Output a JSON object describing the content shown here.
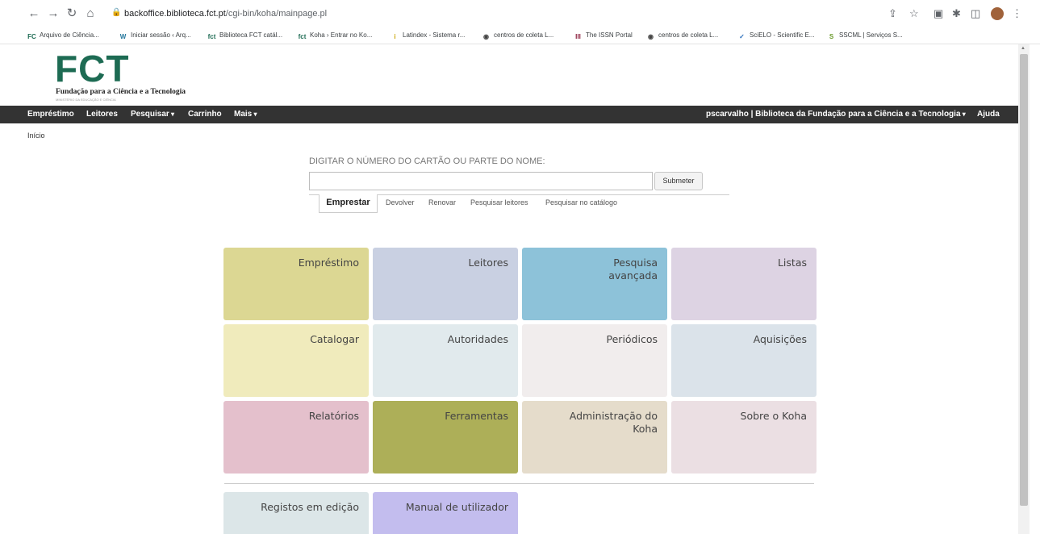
{
  "browser": {
    "url_host": "backoffice.biblioteca.fct.pt",
    "url_path": "/cgi-bin/koha/mainpage.pl",
    "bookmarks": [
      {
        "icon": "FC",
        "label": "Arquivo de Ciência..."
      },
      {
        "icon": "W",
        "label": "Iniciar sessão ‹ Arq..."
      },
      {
        "icon": "fct",
        "label": "Biblioteca FCT catál..."
      },
      {
        "icon": "fct",
        "label": "Koha › Entrar no Ko..."
      },
      {
        "icon": "i",
        "label": "Latindex - Sistema r..."
      },
      {
        "icon": "globe",
        "label": "centros de coleta L..."
      },
      {
        "icon": "ISSN",
        "label": "The ISSN Portal"
      },
      {
        "icon": "globe",
        "label": "centros de coleta L..."
      },
      {
        "icon": "scielo",
        "label": "SciELO - Scientific E..."
      },
      {
        "icon": "sscml",
        "label": "SSCML | Serviços S..."
      }
    ]
  },
  "logo": {
    "mark": "FCT",
    "name": "Fundação para a Ciência e a Tecnologia",
    "subtitle": "MINISTÉRIO DA EDUCAÇÃO E CIÊNCIA"
  },
  "navbar": {
    "left": [
      {
        "label": "Empréstimo",
        "dropdown": false
      },
      {
        "label": "Leitores",
        "dropdown": false
      },
      {
        "label": "Pesquisar",
        "dropdown": true
      },
      {
        "label": "Carrinho",
        "dropdown": false
      },
      {
        "label": "Mais",
        "dropdown": true
      }
    ],
    "user": "pscarvalho",
    "separator": "|",
    "library": "Biblioteca da Fundação para a Ciência e a Tecnologia",
    "help": "Ajuda",
    "caret": "▾"
  },
  "breadcrumb": "Início",
  "search": {
    "label": "DIGITAR O NÚMERO DO CARTÃO OU PARTE DO NOME:",
    "value": "",
    "submit": "Submeter",
    "tabs": [
      {
        "label": "Emprestar",
        "active": true
      },
      {
        "label": "Devolver",
        "active": false
      },
      {
        "label": "Renovar",
        "active": false
      },
      {
        "label": "Pesquisar leitores",
        "active": false
      },
      {
        "label": "Pesquisar no catálogo",
        "active": false
      }
    ]
  },
  "modules": [
    {
      "label": "Empréstimo",
      "color": "#dcd793"
    },
    {
      "label": "Leitores",
      "color": "#c9d0e2"
    },
    {
      "label": "Pesquisa avançada",
      "color": "#8dc2d9"
    },
    {
      "label": "Listas",
      "color": "#ddd3e3"
    },
    {
      "label": "Catalogar",
      "color": "#f0ebbc"
    },
    {
      "label": "Autoridades",
      "color": "#e1eaed"
    },
    {
      "label": "Periódicos",
      "color": "#f1eded"
    },
    {
      "label": "Aquisições",
      "color": "#dbe3ea"
    },
    {
      "label": "Relatórios",
      "color": "#e4c0cc"
    },
    {
      "label": "Ferramentas",
      "color": "#adaf58"
    },
    {
      "label": "Administração do Koha",
      "color": "#e5dccb"
    },
    {
      "label": "Sobre o Koha",
      "color": "#ebdfe3"
    }
  ],
  "extra_modules": [
    {
      "label": "Registos em edição",
      "color": "#dce6e8"
    },
    {
      "label": "Manual de utilizador",
      "color": "#c3bdee"
    }
  ]
}
